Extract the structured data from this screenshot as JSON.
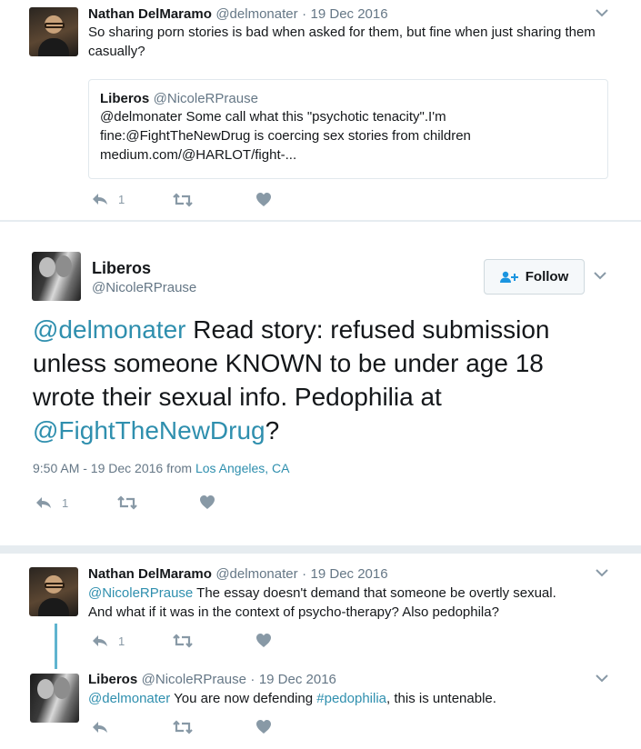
{
  "tweet1": {
    "name": "Nathan DelMaramo",
    "handle": "@delmonater",
    "dot": "·",
    "date": "19 Dec 2016",
    "text": "So sharing porn stories is bad when asked for them, but fine when just sharing them casually?",
    "reply_count": "1",
    "quote": {
      "name": "Liberos",
      "handle": "@NicoleRPrause",
      "line1": "@delmonater Some call what this \"psychotic tenacity\".I'm",
      "line2": "fine:@FightTheNewDrug is coercing sex stories from children",
      "line3": "medium.com/@HARLOT/fight-..."
    }
  },
  "main": {
    "name": "Liberos",
    "handle": "@NicoleRPrause",
    "follow_label": "Follow",
    "text_mention1": "@delmonater",
    "text_part1": " Read story: refused submission unless someone KNOWN to be under age 18 wrote their sexual info. Pedophilia at ",
    "text_mention2": "@FightTheNewDrug",
    "text_part2": "?",
    "timestamp": "9:50 AM - 19 Dec 2016 from ",
    "location": "Los Angeles, CA",
    "reply_count": "1"
  },
  "reply1": {
    "name": "Nathan DelMaramo",
    "handle": "@delmonater",
    "dot": "·",
    "date": "19 Dec 2016",
    "mention": "@NicoleRPrause",
    "text_line1": " The essay doesn't demand that someone be overtly sexual.",
    "text_line2": "And what if it was in the context of psycho-therapy? Also pedophila?",
    "reply_count": "1"
  },
  "reply2": {
    "name": "Liberos",
    "handle": "@NicoleRPrause",
    "dot": "·",
    "date": "19 Dec 2016",
    "mention": "@delmonater",
    "text_a": " You are now defending ",
    "hashtag": "#pedophilia",
    "text_b": ", this is untenable."
  },
  "colors": {
    "link": "#2f8fae",
    "meta": "#657786",
    "action_icon": "#8899a6",
    "background": "#e6ecf0"
  }
}
